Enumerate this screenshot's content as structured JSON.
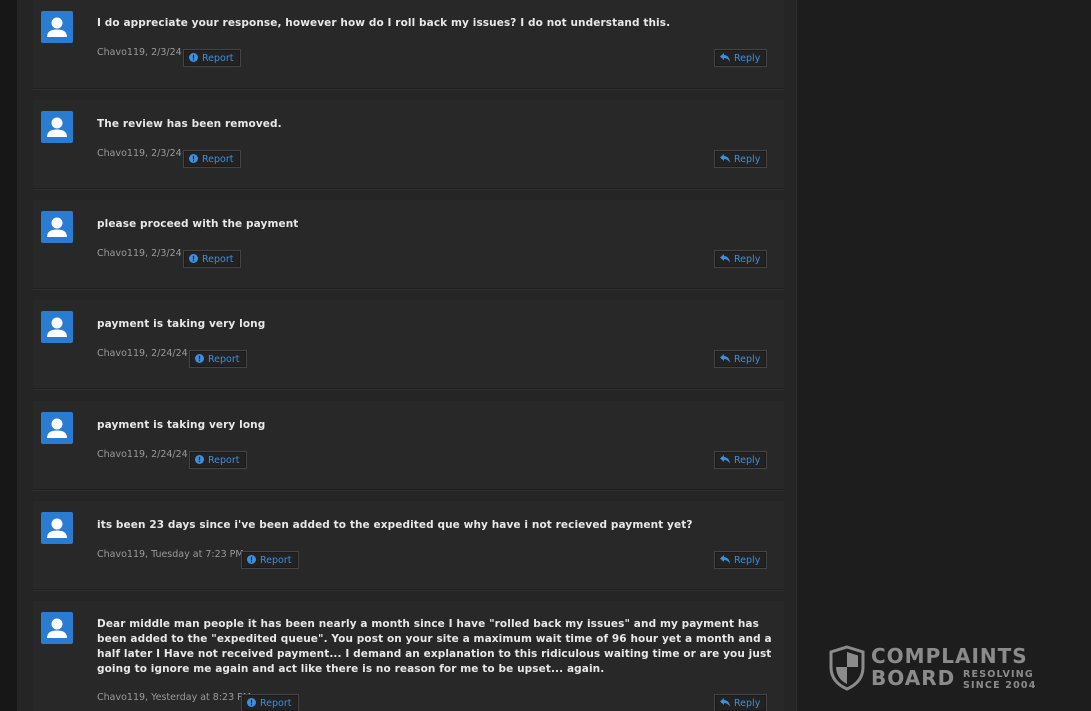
{
  "comments": [
    {
      "text": "I do appreciate your response, however how do I roll back my issues? I do not understand this.",
      "meta": "Chavo119, 2/3/24"
    },
    {
      "text": "The review has been removed.",
      "meta": "Chavo119, 2/3/24"
    },
    {
      "text": "please proceed with the payment",
      "meta": "Chavo119, 2/3/24"
    },
    {
      "text": "payment is taking very long",
      "meta": "Chavo119, 2/24/24"
    },
    {
      "text": "payment is taking very long",
      "meta": "Chavo119, 2/24/24"
    },
    {
      "text": "its been 23 days since i've been added to the expedited que why have i not recieved payment yet?",
      "meta": "Chavo119, Tuesday at 7:23 PM"
    },
    {
      "text": "Dear middle man people it has been nearly a month since I have \"rolled back my issues\" and my payment has been added to the \"expedited queue\". You post on your site a maximum wait time of 96 hour yet a month and a half later I Have not received payment... I demand an explanation to this ridiculous waiting time or are you just going to ignore me again and act like there is no reason for me to be upset... again.",
      "meta": "Chavo119, Yesterday at 8:23 PM"
    }
  ],
  "buttons": {
    "report_label": "Report",
    "reply_label": "Reply"
  },
  "icons": {
    "avatar": "user-silhouette-icon",
    "report": "exclamation-circle-icon",
    "reply": "reply-arrow-icon"
  },
  "colors": {
    "accent": "#2a7bd2",
    "link": "#3d8fe0",
    "background": "#1d1d1d",
    "panel": "#252525"
  },
  "watermark": {
    "word1": "COMPLAINTS",
    "word2": "BOARD",
    "tag1": "RESOLVING",
    "tag2": "SINCE 2004"
  }
}
